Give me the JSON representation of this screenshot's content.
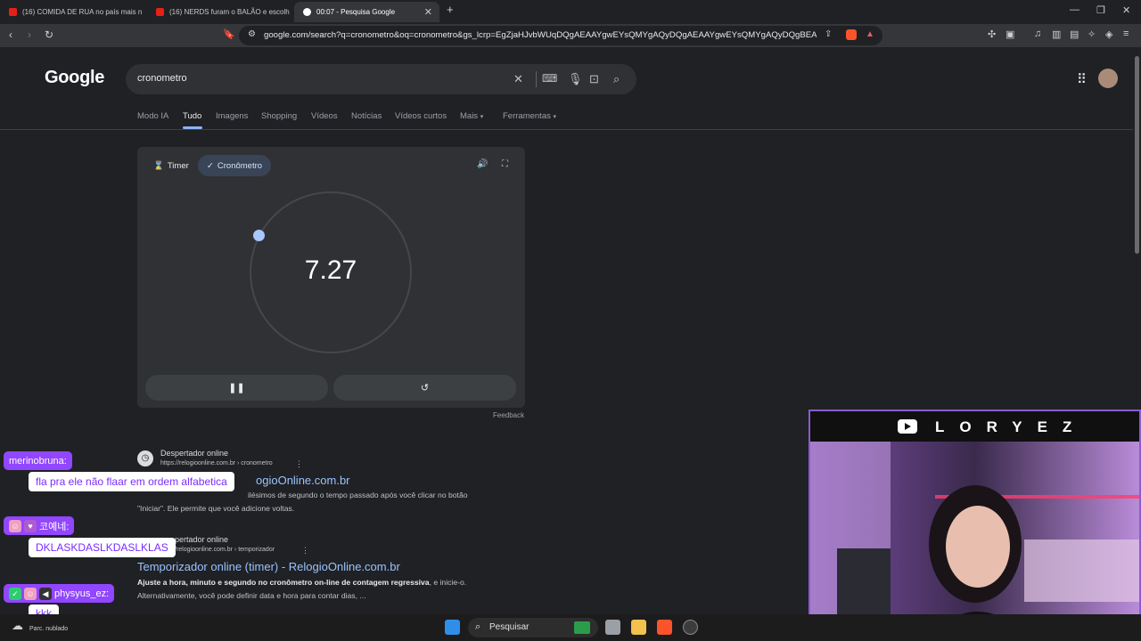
{
  "browser": {
    "tabs": [
      {
        "title": "(16) COMIDA DE RUA no país mais n",
        "active": false
      },
      {
        "title": "(16) NERDS furam o BALÃO e escolh",
        "active": false
      },
      {
        "title": "00:07 - Pesquisa Google",
        "active": true
      }
    ],
    "new_tab_icon": "plus-icon",
    "url": "google.com/search?q=cronometro&oq=cronometro&gs_lcrp=EgZjaHJvbWUqDQgAEAAYgwEYsQMYgAQyDQgAEAAYgwEYsQMYgAQyDQgBEAAYgwE..."
  },
  "google": {
    "logo": "Google",
    "query": "cronometro",
    "nav_tabs": [
      "Modo IA",
      "Tudo",
      "Imagens",
      "Shopping",
      "Vídeos",
      "Notícias",
      "Vídeos curtos",
      "Mais",
      "Ferramentas"
    ],
    "active_tab": "Tudo"
  },
  "stopwatch": {
    "timer_label": "Timer",
    "stopwatch_label": "Cronômetro",
    "elapsed": "7.27",
    "feedback": "Feedback"
  },
  "results": [
    {
      "site": "Despertador online",
      "url": "https://relogioonline.com.br › cronometro",
      "title_visible": "ogioOnline.com.br",
      "snippet_line1": "ilésimos de segundo o tempo passado após você clicar no botão",
      "snippet_line2": "\"Iniciar\". Ele permite que você adicione voltas."
    },
    {
      "site": "pertador online",
      "url": "/relogioonline.com.br › temporizador",
      "title_visible": "Temporizador online (timer) - RelogioOnline.com.br",
      "snippet_bold": "Ajuste a hora, minuto e segundo no cronômetro on-line de contagem regressiva",
      "snippet_rest": ", e inicie-o.",
      "snippet_line2": "Alternativamente, você pode definir data e hora para contar dias, ..."
    }
  ],
  "chat": [
    {
      "user": "merinobruna:",
      "message": "fla pra ele não flaar em ordem alfabetica"
    },
    {
      "user": "코예네:",
      "message": "DKLASKDASLKDASLKLAS"
    },
    {
      "user": "physyus_ez:",
      "message": "kkk"
    }
  ],
  "webcam": {
    "handle": "LORYEZ"
  },
  "taskbar": {
    "weather": "Parc. nublado",
    "search": "Pesquisar"
  },
  "colors": {
    "accent_blue": "#8ab4f8",
    "chat_purple": "#9146ff",
    "link_blue": "#99c3ff"
  }
}
